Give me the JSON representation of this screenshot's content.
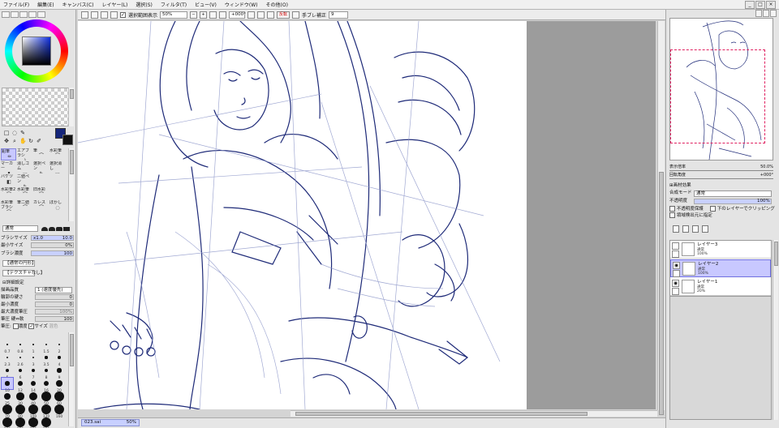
{
  "menu": [
    "ファイル(F)",
    "編集(E)",
    "キャンバス(C)",
    "レイヤー(L)",
    "選択(S)",
    "フィルタ(T)",
    "ビュー(V)",
    "ウィンドウ(W)",
    "その他(O)"
  ],
  "window_controls": {
    "minimize": "_",
    "restore": "□",
    "close": "×"
  },
  "toolbar": {
    "selection_source_label": "選択範囲表示",
    "zoom": "50%",
    "rotation": "+000°",
    "flip_label": "反転",
    "stabilizer_label": "手ブレ補正",
    "stabilizer_value": "9"
  },
  "colors": {
    "primary": "#15257a",
    "secondary": "#111111",
    "selection": "#c8c8ff",
    "stroke": "#1e2a78"
  },
  "tools": [
    {
      "label": "鉛筆",
      "icon": "pencil-icon"
    },
    {
      "label": "エアブラシ",
      "icon": "airbrush-icon"
    },
    {
      "label": "筆",
      "icon": "brush-icon"
    },
    {
      "label": "水彩筆",
      "icon": "watercolor-icon"
    },
    {
      "label": "マーカー",
      "icon": "marker-icon"
    },
    {
      "label": "消しゴム",
      "icon": "eraser-icon"
    },
    {
      "label": "選択ペン",
      "icon": "select-pen-icon"
    },
    {
      "label": "選択消し",
      "icon": "select-erase-icon"
    },
    {
      "label": "バケツ",
      "icon": "bucket-icon"
    },
    {
      "label": "二値ペン",
      "icon": "binary-pen-icon"
    },
    {
      "label": "",
      "icon": ""
    },
    {
      "label": "",
      "icon": ""
    },
    {
      "label": "水彩筆2",
      "icon": "watercolor2-icon"
    },
    {
      "label": "水彩筆",
      "icon": "watercolor3-icon"
    },
    {
      "label": "旧水彩",
      "icon": "old-watercolor-icon"
    },
    {
      "label": "",
      "icon": ""
    },
    {
      "label": "水彩筆ブラシ",
      "icon": "brush2-icon"
    },
    {
      "label": "筆二値",
      "icon": "brush-binary-icon"
    },
    {
      "label": "カレス",
      "icon": "cares-icon"
    },
    {
      "label": "ぼかし",
      "icon": "blur-icon"
    }
  ],
  "brush": {
    "blend_mode": "通常",
    "size_label": "ブラシサイズ",
    "size_multiplier": "x1.0",
    "size_value": "10.0",
    "min_size_label": "最小サイズ",
    "min_size_value": "0%",
    "density_label": "ブラシ濃度",
    "density_value": "100",
    "shape_label": "【通常の円形】",
    "texture_label": "【テクスチャなし】",
    "advanced_label": "詳細設定",
    "quality_label": "描画品質",
    "quality_value": "1 (速度優先)",
    "edge_label": "輪郭の硬さ",
    "edge_value": "0",
    "min_density_label": "最小濃度",
    "min_density_value": "0",
    "max_density_pressure_label": "最大濃度筆圧",
    "max_density_pressure_value": "100%",
    "pressure_label": "筆圧 硬⇔軟",
    "pressure_value": "100",
    "pressure2_label": "筆圧:",
    "pressure_density": "濃度",
    "pressure_size": "サイズ",
    "pressure_blend": "混色"
  },
  "brush_sizes": [
    "0.7",
    "0.8",
    "1",
    "1.5",
    "2",
    "2.3",
    "2.6",
    "3",
    "3.5",
    "4",
    "5",
    "6",
    "7",
    "8",
    "9",
    "10",
    "12",
    "14",
    "16",
    "20",
    "25",
    "30",
    "40",
    "50",
    "60",
    "70",
    "80",
    "100",
    "120",
    "160",
    "200",
    "250",
    "300",
    "350"
  ],
  "file_tab": {
    "name": "023.sai",
    "zoom": "50%"
  },
  "navigator": {
    "zoom_label": "表示倍率",
    "zoom_value": "50.0%",
    "angle_label": "回転角度",
    "angle_value": "+000°"
  },
  "layer_panel": {
    "effect_label": "画材効果",
    "blend_label": "合成モード",
    "blend_value": "通常",
    "opacity_label": "不透明度",
    "opacity_value": "100%",
    "preserve_label": "不透明度保護",
    "clip_label": "下のレイヤーでクリッピング",
    "source_label": "領域検出元に指定"
  },
  "layers": [
    {
      "name": "レイヤー3",
      "mode": "通常",
      "opacity": "100%",
      "selected": false,
      "visible": false
    },
    {
      "name": "レイヤー2",
      "mode": "通常",
      "opacity": "100%",
      "selected": true,
      "visible": true
    },
    {
      "name": "レイヤー1",
      "mode": "通常",
      "opacity": "20%",
      "selected": false,
      "visible": true
    }
  ]
}
